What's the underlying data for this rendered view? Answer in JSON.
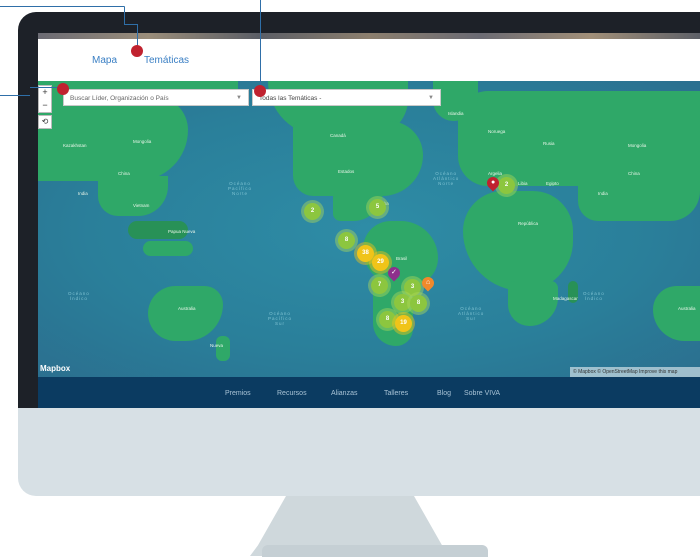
{
  "nav": {
    "map": "Mapa",
    "themes": "Temáticas"
  },
  "search": {
    "placeholder": "Buscar Líder, Organización o País"
  },
  "theme_select": {
    "value": "Todas las Temáticas -"
  },
  "controls": {
    "zoom_in": "+",
    "zoom_out": "−",
    "reset": "⟲"
  },
  "map": {
    "attribution": "© Mapbox © OpenStreetMap Improve this map",
    "logo": "Mapbox",
    "clusters": [
      {
        "count": "2",
        "color": "green"
      },
      {
        "count": "5",
        "color": "green"
      },
      {
        "count": "8",
        "color": "green"
      },
      {
        "count": "38",
        "color": "yellow"
      },
      {
        "count": "29",
        "color": "yellow"
      },
      {
        "count": "7",
        "color": "green"
      },
      {
        "count": "3",
        "color": "green"
      },
      {
        "count": "3",
        "color": "green"
      },
      {
        "count": "8",
        "color": "green"
      },
      {
        "count": "8",
        "color": "green"
      },
      {
        "count": "19",
        "color": "yellow"
      },
      {
        "count": "2",
        "color": "green"
      }
    ]
  },
  "footer": {
    "links": [
      "Premios",
      "Recursos",
      "Alianzas",
      "Talleres",
      "Blog",
      "Sobre VIVA"
    ]
  },
  "colors": {
    "accent_dot": "#c0222f",
    "callout_line": "#2f6fa8",
    "footer_bg": "#0b3b61",
    "cluster_green": "#8cc63f",
    "cluster_yellow": "#f0c419"
  }
}
